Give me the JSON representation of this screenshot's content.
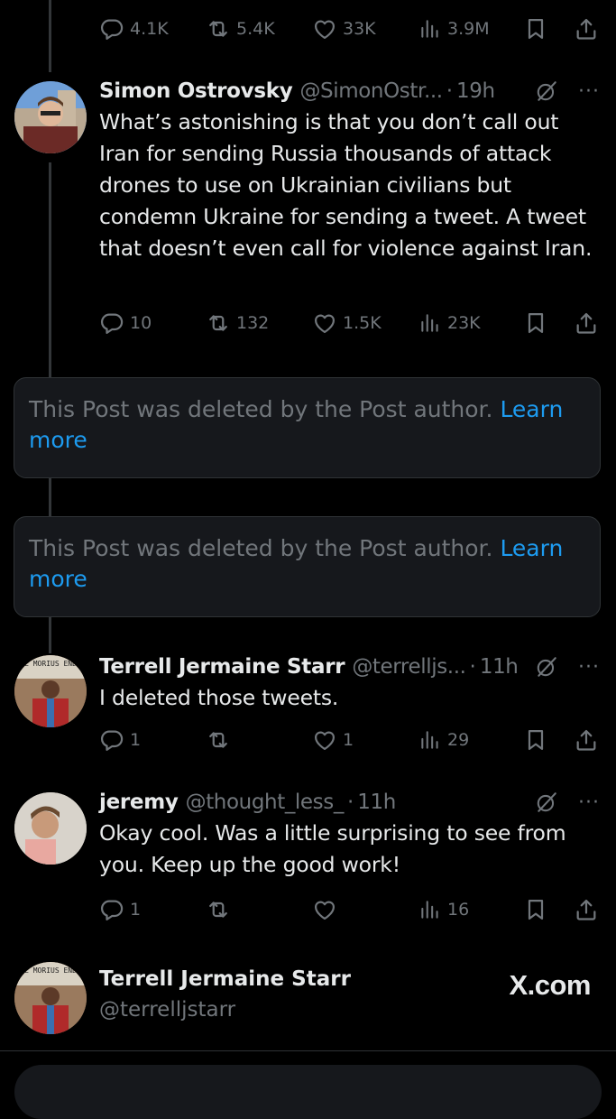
{
  "top_actions": {
    "replies": "4.1K",
    "reposts": "5.4K",
    "likes": "33K",
    "views": "3.9M"
  },
  "posts": [
    {
      "name": "Simon Ostrovsky",
      "handle": "@SimonOstr...",
      "sep": "·",
      "time": "19h",
      "text": "What’s astonishing is that you don’t call out Iran for sending Russia thousands of attack drones to use on Ukrainian civilians but condemn Ukraine for sending a tweet. A tweet that doesn’t even call for violence against Iran.",
      "replies": "10",
      "reposts": "132",
      "likes": "1.5K",
      "views": "23K"
    },
    {
      "name": "Terrell Jermaine Starr",
      "handle": "@terrelljs...",
      "sep": "·",
      "time": "11h",
      "text": "I deleted those tweets.",
      "replies": "1",
      "reposts": "",
      "likes": "1",
      "views": "29"
    },
    {
      "name": "jeremy",
      "handle": "@thought_less_",
      "sep": "·",
      "time": "11h",
      "text": "Okay cool. Was a little surprising to see from you. Keep up the good work!",
      "replies": "1",
      "reposts": "",
      "likes": "",
      "views": "16"
    }
  ],
  "deleted_notice": {
    "text": "This Post was deleted by the Post author.",
    "link": "Learn more"
  },
  "more_label": "···",
  "footer": {
    "name": "Terrell Jermaine Starr",
    "handle": "@terrelljstarr",
    "watermark": "X.com"
  },
  "avatar_sign_text": "FREE MORIUS ENDERS",
  "colors": {
    "background": "#000000",
    "text": "#e7e9ea",
    "muted": "#71767b",
    "link": "#1d9bf0",
    "card": "#16181c",
    "border": "#2f3336"
  },
  "icons": [
    "reply-icon",
    "repost-icon",
    "like-icon",
    "views-icon",
    "bookmark-icon",
    "share-icon",
    "grok-icon",
    "more-icon"
  ]
}
